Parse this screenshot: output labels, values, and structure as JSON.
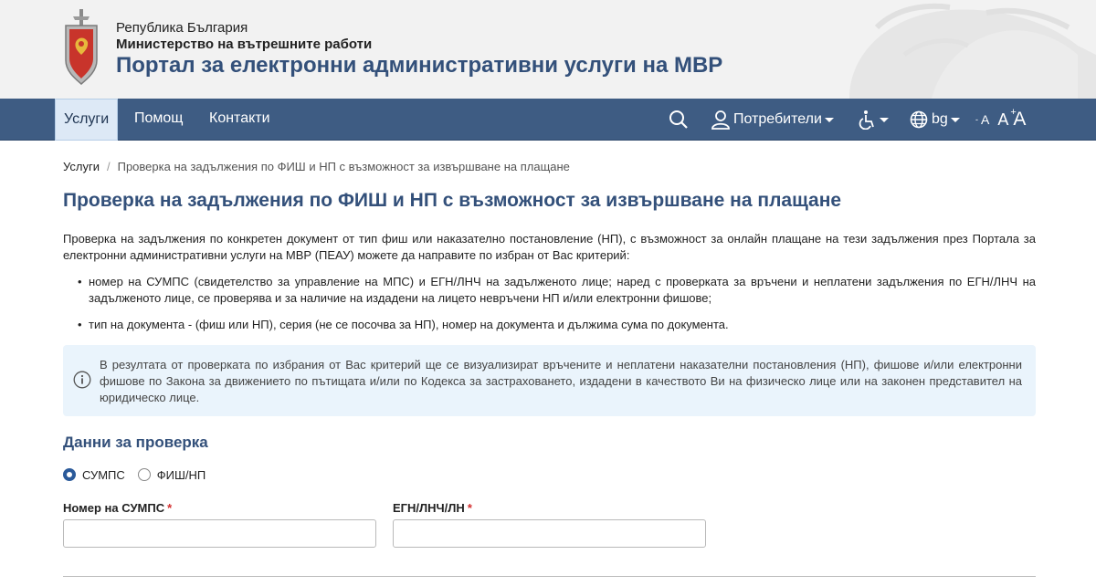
{
  "header": {
    "org_line1": "Република България",
    "org_line2": "Министерство на вътрешните работи",
    "portal_title": "Портал за електронни административни услуги на МВР"
  },
  "navbar": {
    "items": [
      {
        "label": "Услуги",
        "active": true
      },
      {
        "label": "Помощ",
        "active": false
      },
      {
        "label": "Контакти",
        "active": false
      }
    ],
    "users_label": "Потребители",
    "language": "bg",
    "font_small": "A",
    "font_normal": "A",
    "font_large": "A"
  },
  "breadcrumb": {
    "home": "Услуги",
    "separator": "/",
    "current": "Проверка на задължения по ФИШ и НП с възможност за извършване на плащане"
  },
  "page": {
    "title": "Проверка на задължения по ФИШ и НП с възможност за извършване на плащане",
    "intro": "Проверка на задължения по конкретен документ от тип фиш или наказателно постановление (НП), с възможност за онлайн плащане на тези задължения през Портала за електронни административни услуги на МВР (ПЕАУ) можете да направите по избран от Вас критерий:",
    "bullets": [
      "номер на СУМПС (свидетелство за управление на МПС) и ЕГН/ЛНЧ на задълженото лице;  наред с проверката за връчени и неплатени задължения по ЕГН/ЛНЧ на задълженото лице, се проверява и за наличие на издадени на лицето невръчени НП и/или електронни фишове;",
      "тип на документа - (фиш или НП), серия (не се посочва за НП), номер на документа и дължима сума по документа."
    ],
    "info_text": "В резултата от проверката по избрания от Вас критерий ще се визуализират връчените и неплатени наказателни постановления (НП), фишове и/или електронни фишове по Закона за движението по пътищата и/или по Кодекса за застраховането, издадени в качеството Ви на физическо лице или на законен представител на юридическо лице."
  },
  "form": {
    "section_title": "Данни за проверка",
    "radio_options": [
      {
        "label": "СУМПС",
        "checked": true
      },
      {
        "label": "ФИШ/НП",
        "checked": false
      }
    ],
    "field1_label": "Номер на СУМПС",
    "field1_value": "",
    "field2_label": "ЕГН/ЛНЧ/ЛН",
    "field2_value": "",
    "required_mark": "*"
  },
  "colors": {
    "navbar_bg": "#3e5c83",
    "title_blue": "#33507a",
    "info_bg": "#eaf4fc",
    "radio_checked": "#2b5a9a",
    "required_red": "#d32f2f"
  },
  "icons": {
    "emblem": "ministry-coat-of-arms",
    "search": "search-icon",
    "user": "user-icon",
    "accessibility": "wheelchair-icon",
    "language": "globe-icon",
    "info": "info-circle-icon"
  }
}
